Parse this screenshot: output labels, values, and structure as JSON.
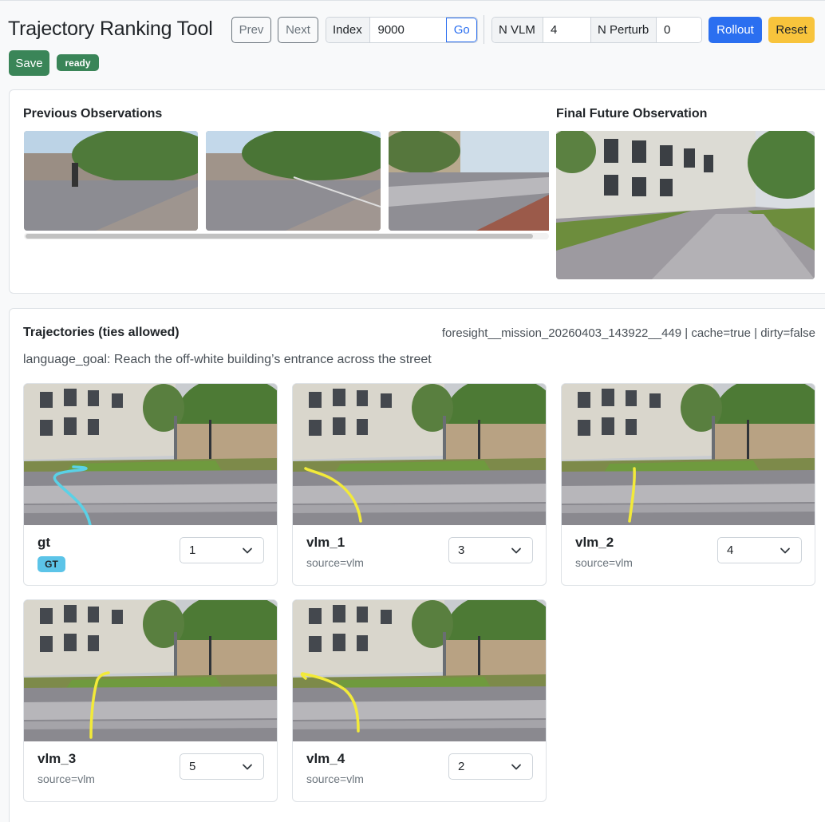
{
  "app": {
    "title": "Trajectory Ranking Tool"
  },
  "toolbar": {
    "prev_label": "Prev",
    "next_label": "Next",
    "index_label": "Index",
    "index_value": "9000",
    "go_label": "Go",
    "n_vlm_label": "N VLM",
    "n_vlm_value": "4",
    "n_perturb_label": "N Perturb",
    "n_perturb_value": "0",
    "rollout_label": "Rollout",
    "reset_label": "Reset",
    "save_label": "Save",
    "status_badge": "ready"
  },
  "observations": {
    "previous_title": "Previous Observations",
    "final_title": "Final Future Observation"
  },
  "trajectories": {
    "title": "Trajectories (ties allowed)",
    "meta": "foresight__mission_20260403_143922__449 | cache=true | dirty=false",
    "goal": "language_goal: Reach the off-white building’s entrance across the street",
    "items": [
      {
        "name": "gt",
        "badge": "GT",
        "source": "",
        "rank": "1",
        "path_color": "#5ad1e6"
      },
      {
        "name": "vlm_1",
        "badge": "",
        "source": "source=vlm",
        "rank": "3",
        "path_color": "#f2ea3a"
      },
      {
        "name": "vlm_2",
        "badge": "",
        "source": "source=vlm",
        "rank": "4",
        "path_color": "#f2ea3a"
      },
      {
        "name": "vlm_3",
        "badge": "",
        "source": "source=vlm",
        "rank": "5",
        "path_color": "#f2ea3a"
      },
      {
        "name": "vlm_4",
        "badge": "",
        "source": "source=vlm",
        "rank": "2",
        "path_color": "#f2ea3a"
      }
    ]
  },
  "colors": {
    "primary": "#2b6ff0",
    "warning": "#f8c43c",
    "success": "#3a8558",
    "info": "#5cc4e8"
  }
}
